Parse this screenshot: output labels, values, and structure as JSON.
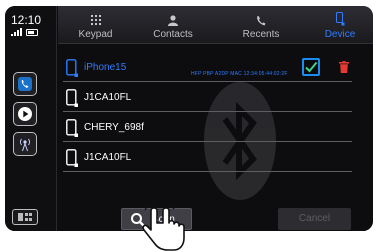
{
  "status": {
    "time": "12:10"
  },
  "tabs": [
    {
      "label": "Keypad",
      "icon": "keypad-icon",
      "active": false
    },
    {
      "label": "Contacts",
      "icon": "contacts-icon",
      "active": false
    },
    {
      "label": "Recents",
      "icon": "recents-icon",
      "active": false
    },
    {
      "label": "Device",
      "icon": "device-icon",
      "active": true
    }
  ],
  "devices": [
    {
      "name": "iPhone15",
      "meta": "HFP PBP A2DP MAC 12:34:05:44:02:2F",
      "selected": true
    },
    {
      "name": "J1CA10FL",
      "meta": "",
      "selected": false
    },
    {
      "name": "CHERY_698f",
      "meta": "",
      "selected": false
    },
    {
      "name": "J1CA10FL",
      "meta": "",
      "selected": false
    }
  ],
  "buttons": {
    "scan": "Scan",
    "cancel": "Cancel"
  },
  "colors": {
    "accent": "#2f7cff",
    "delete": "#e53935",
    "background": "#0c0c0e"
  }
}
